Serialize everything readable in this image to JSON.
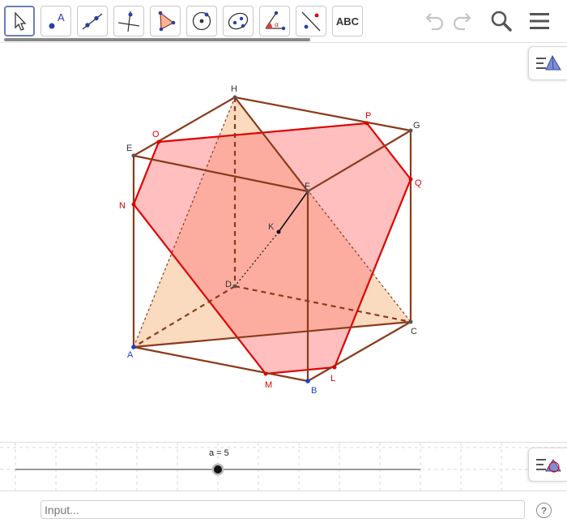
{
  "toolbar": {
    "tools": [
      {
        "name": "move-tool",
        "icon": "arrow-cursor-icon",
        "selected": true
      },
      {
        "name": "point-tool",
        "icon": "point-icon",
        "text": "A"
      },
      {
        "name": "line-tool",
        "icon": "line-through-points-icon"
      },
      {
        "name": "perpendicular-tool",
        "icon": "perpendicular-line-icon"
      },
      {
        "name": "polygon-tool",
        "icon": "polygon-icon"
      },
      {
        "name": "circle-tool",
        "icon": "circle-center-point-icon"
      },
      {
        "name": "conic-tool",
        "icon": "ellipse-icon"
      },
      {
        "name": "angle-tool",
        "icon": "angle-icon",
        "text": "α"
      },
      {
        "name": "reflect-tool",
        "icon": "reflect-about-line-icon"
      },
      {
        "name": "text-tool",
        "icon": "text-icon",
        "text": "ABC"
      }
    ],
    "undo_icon": "undo-icon",
    "redo_icon": "redo-icon",
    "search_icon": "search-icon",
    "menu_icon": "hamburger-menu-icon"
  },
  "points": {
    "H": "H",
    "P": "P",
    "G": "G",
    "O": "O",
    "E": "E",
    "F": "F",
    "Q": "Q",
    "N": "N",
    "K": "K",
    "D": "D",
    "C": "C",
    "A": "A",
    "L": "L",
    "M": "M",
    "B": "B"
  },
  "slider": {
    "label": "a = 5",
    "value": 5
  },
  "input": {
    "placeholder": "Input..."
  },
  "help": {
    "label": "?"
  },
  "colors": {
    "cube_edge": "#8b3a1a",
    "section_edge": "#e00000",
    "section_fill": "#ff8080",
    "tetra_fill": "#f5b070",
    "label_red": "#e00000",
    "label_blue": "#1a3fd0",
    "label_dark": "#333333"
  }
}
